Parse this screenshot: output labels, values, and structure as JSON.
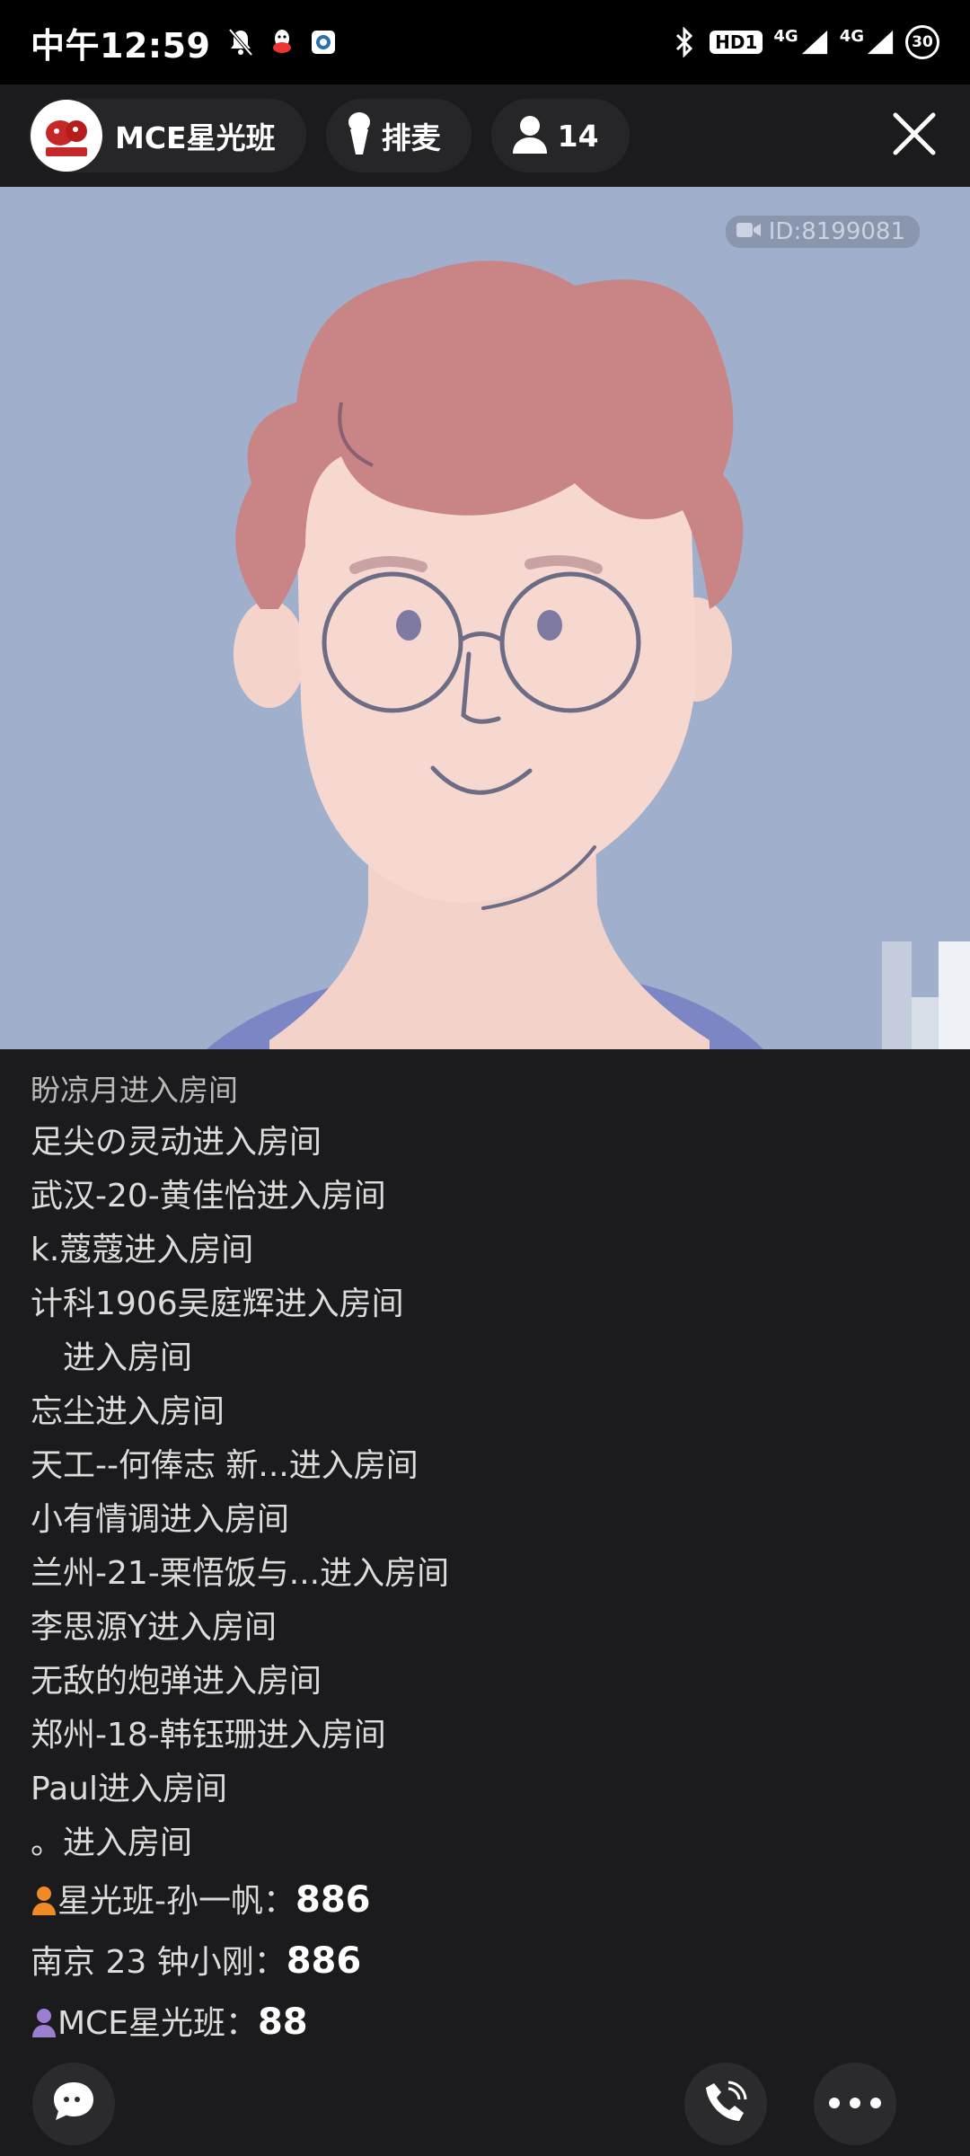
{
  "status_bar": {
    "time": "中午12:59",
    "hd_label": "HD1",
    "net1": "4G",
    "net2": "4G",
    "battery": "30"
  },
  "header": {
    "room_name": "MCE星光班",
    "queue_label": "排麦",
    "member_count": "14"
  },
  "video": {
    "room_id": "ID:8199081"
  },
  "chat": {
    "cut_line": "盼凉月进入房间",
    "lines": [
      "足尖の灵动进入房间",
      "武汉-20-黄佳怡进入房间",
      "k.蔻蔻进入房间",
      "计科1906吴庭辉进入房间",
      "　进入房间",
      "忘尘进入房间",
      "天工--何俸志  新...进入房间",
      "小有情调进入房间",
      "兰州-21-栗悟饭与...进入房间",
      "李思源Y进入房间",
      "无敌的炮弹进入房间",
      "郑州-18-韩钰珊进入房间",
      "Paul进入房间",
      "。进入房间"
    ],
    "messages": [
      {
        "name": "星光班-孙一帆：",
        "text": "886"
      },
      {
        "name": "南京 23 钟小刚：",
        "text": "886"
      },
      {
        "name": "MCE星光班：",
        "text": "88"
      }
    ]
  },
  "colors": {
    "video_bg": "#a0b0cc",
    "hair": "#c98486",
    "skin": "#f6d5cd",
    "dark_bg": "#1b1b1d"
  }
}
